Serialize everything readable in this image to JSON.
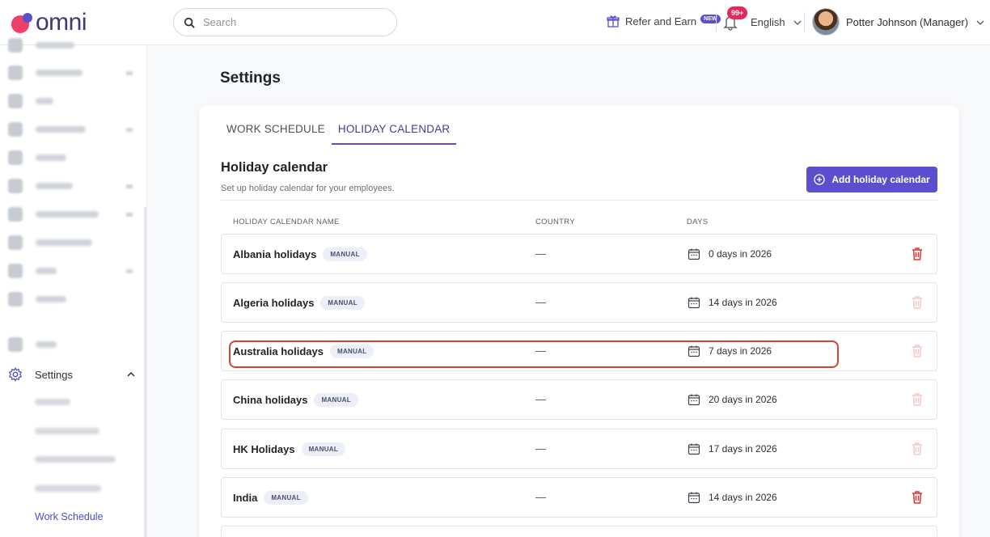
{
  "app": {
    "logo_text": "omni"
  },
  "header": {
    "search_placeholder": "Search",
    "refer_label": "Refer and Earn",
    "refer_badge": "NEW",
    "notifications_count": "99+",
    "language": "English",
    "user_name": "Potter Johnson (Manager)"
  },
  "sidebar": {
    "settings_label": "Settings",
    "active_sub_label": "Work Schedule"
  },
  "page": {
    "title": "Settings",
    "tabs": [
      {
        "label": "WORK SCHEDULE",
        "active": false
      },
      {
        "label": "HOLIDAY CALENDAR",
        "active": true
      }
    ],
    "section_title": "Holiday calendar",
    "section_subtitle": "Set up holiday calendar for your employees.",
    "add_button_label": "Add holiday calendar",
    "columns": [
      "HOLIDAY CALENDAR NAME",
      "COUNTRY",
      "DAYS"
    ],
    "rows": [
      {
        "name": "Albania holidays",
        "badge": "MANUAL",
        "country": "—",
        "days": "0 days in 2026",
        "delete_enabled": true
      },
      {
        "name": "Algeria holidays",
        "badge": "MANUAL",
        "country": "—",
        "days": "14 days in 2026",
        "delete_enabled": false
      },
      {
        "name": "Australia holidays",
        "badge": "MANUAL",
        "country": "—",
        "days": "7 days in 2026",
        "delete_enabled": false
      },
      {
        "name": "China holidays",
        "badge": "MANUAL",
        "country": "—",
        "days": "20 days in 2026",
        "delete_enabled": false
      },
      {
        "name": "HK Holidays",
        "badge": "MANUAL",
        "country": "—",
        "days": "17 days in 2026",
        "delete_enabled": false
      },
      {
        "name": "India",
        "badge": "MANUAL",
        "country": "—",
        "days": "14 days in 2026",
        "delete_enabled": true
      }
    ]
  },
  "colors": {
    "accent": "#5b4fcf",
    "delete_active": "#e0322e",
    "delete_disabled": "#f6c9c7",
    "highlight": "#d74433"
  }
}
